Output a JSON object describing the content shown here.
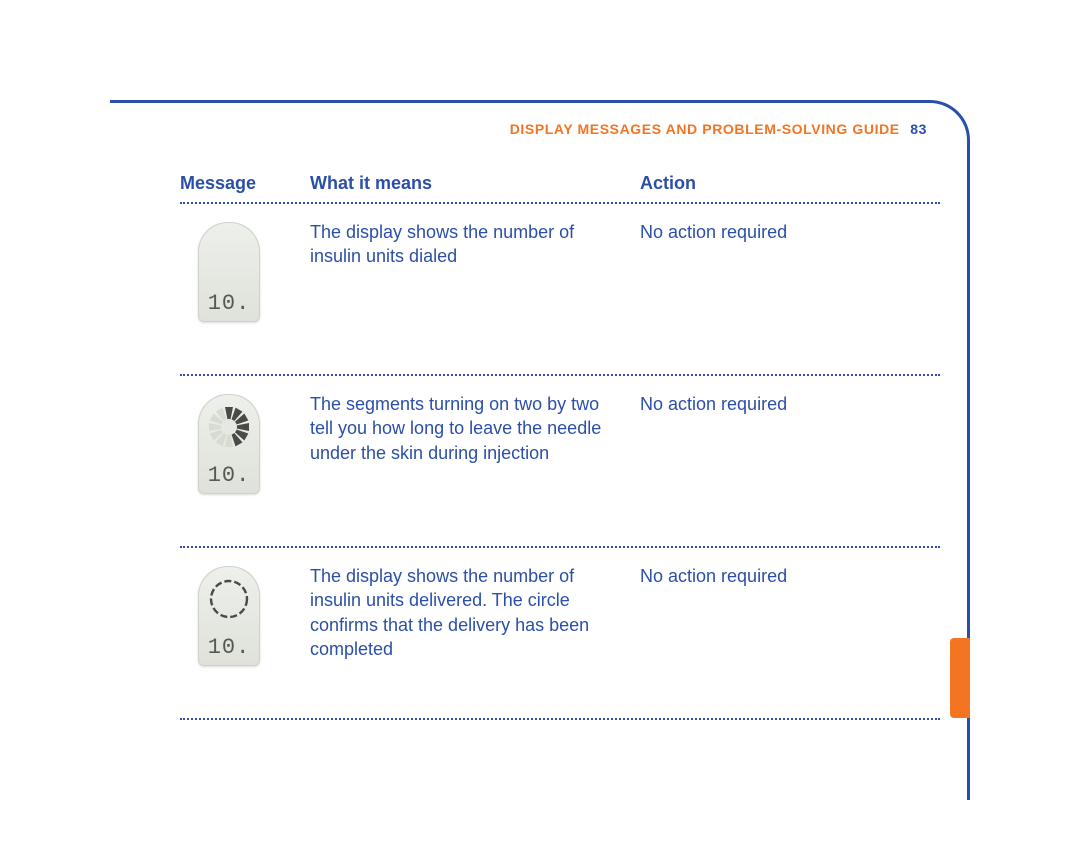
{
  "header": {
    "section_title": "DISPLAY MESSAGES AND PROBLEM-SOLVING GUIDE",
    "page_number": "83"
  },
  "columns": {
    "message": "Message",
    "meaning": "What it means",
    "action": "Action"
  },
  "rows": [
    {
      "icon": "device-dialed",
      "readout": "10.",
      "meaning": "The display shows the number of insulin units dialed",
      "action": "No action required"
    },
    {
      "icon": "device-segments",
      "readout": "10.",
      "meaning": "The segments turning on two by two tell you how long to leave the needle under the skin during injection",
      "action": "No action required"
    },
    {
      "icon": "device-complete",
      "readout": "10.",
      "meaning": "The display shows the number of insulin units delivered. The circle confirms that the delivery has been completed",
      "action": "No action required"
    }
  ]
}
